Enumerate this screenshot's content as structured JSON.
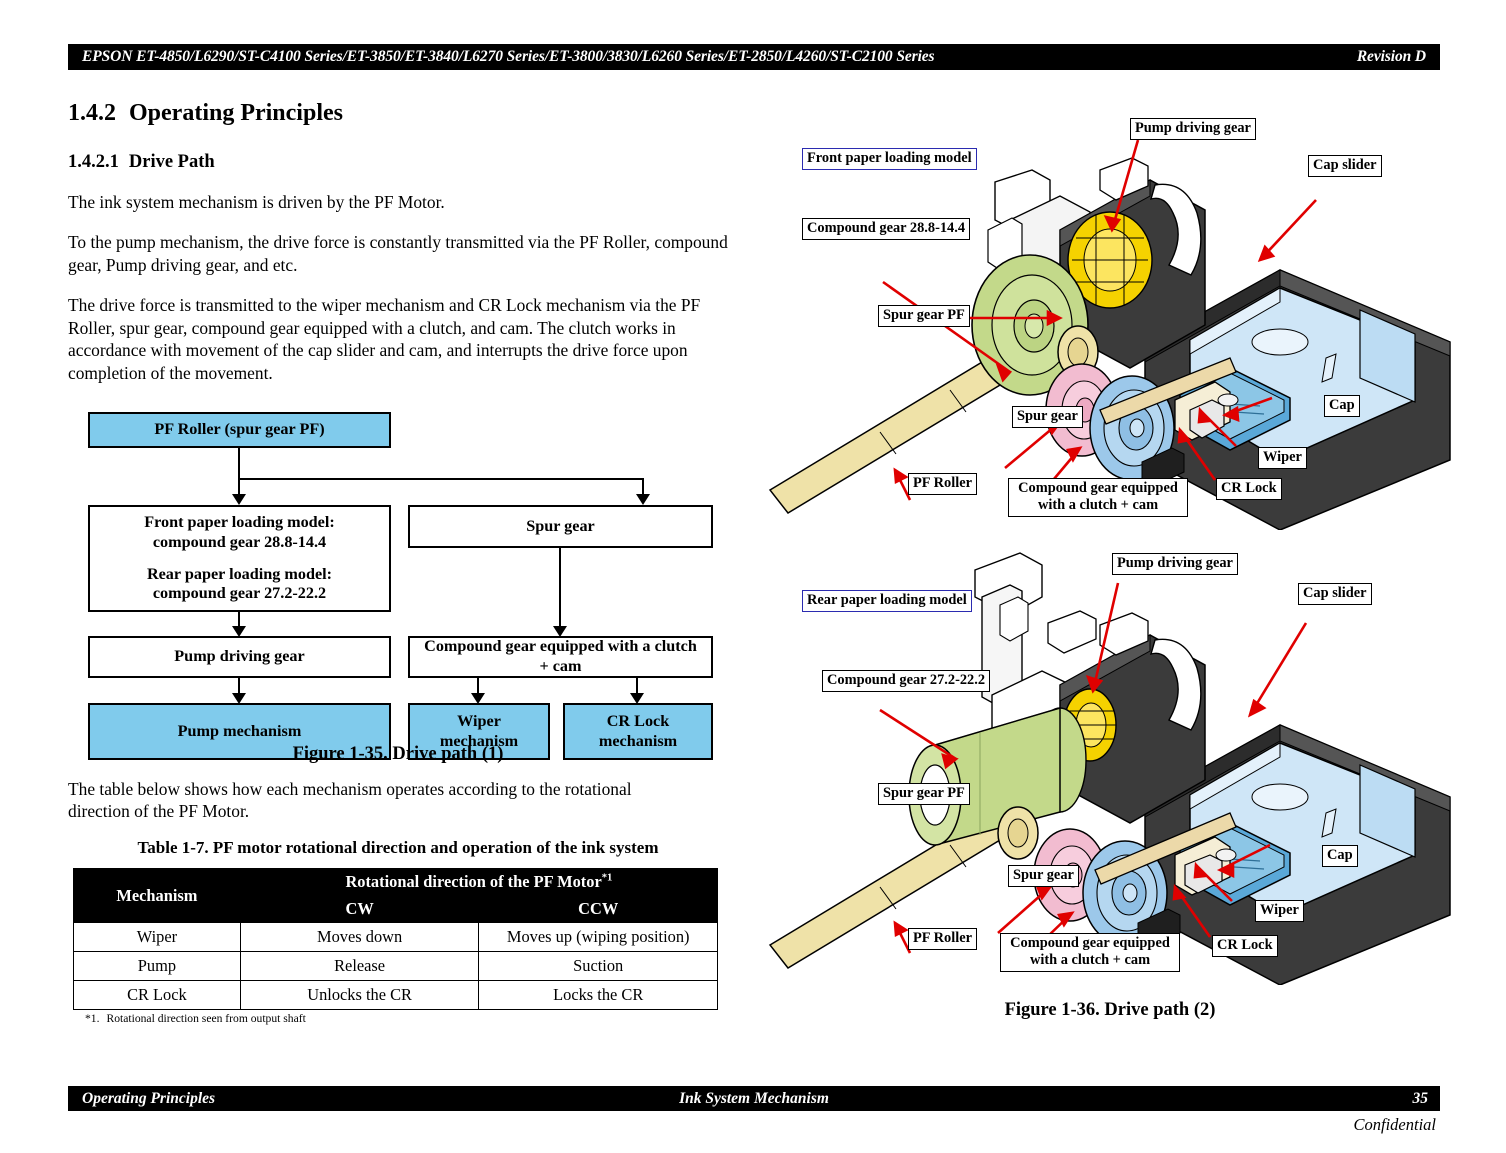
{
  "header": {
    "title": "EPSON ET-4850/L6290/ST-C4100 Series/ET-3850/ET-3840/L6270 Series/ET-3800/3830/L6260 Series/ET-2850/L4260/ST-C2100 Series",
    "revision": "Revision D"
  },
  "section": {
    "number": "1.4.2",
    "title": "Operating Principles",
    "sub_number": "1.4.2.1",
    "sub_title": "Drive Path",
    "paragraphs": [
      "The ink system mechanism is driven by the PF Motor.",
      "To the pump mechanism, the drive force is constantly transmitted via the PF Roller, compound gear, Pump driving gear, and etc.",
      "The drive force is transmitted to the wiper mechanism and CR Lock mechanism via the PF Roller, spur gear, compound gear equipped with a clutch, and cam. The clutch works in accordance with movement of the cap slider and cam, and interrupts the drive force upon completion of the movement.",
      "The table below shows how each mechanism operates according to the rotational direction of the PF Motor."
    ]
  },
  "flowchart": {
    "root": "PF Roller (spur gear PF)",
    "left_branch_line1": "Front paper loading model:",
    "left_branch_line2": "compound gear 28.8-14.4",
    "left_branch_line3": "Rear paper loading model:",
    "left_branch_line4": "compound gear 27.2-22.2",
    "right_branch": "Spur gear",
    "pump_driving_gear": "Pump driving gear",
    "clutch_cam_line1": "Compound gear equipped with a clutch",
    "clutch_cam_line2": "+ cam",
    "pump_mechanism": "Pump mechanism",
    "wiper_mechanism_line1": "Wiper",
    "wiper_mechanism_line2": "mechanism",
    "crlock_mechanism_line1": "CR Lock",
    "crlock_mechanism_line2": "mechanism",
    "caption": "Figure 1-35.  Drive path (1)",
    "accent_color": "#80cbec"
  },
  "table": {
    "title": "Table 1-7.  PF motor rotational direction and operation of the ink system",
    "header_mechanism": "Mechanism",
    "header_group": "Rotational direction of the PF Motor",
    "header_group_sup": "*1",
    "header_cw": "CW",
    "header_ccw": "CCW",
    "rows": [
      {
        "mechanism": "Wiper",
        "cw": "Moves down",
        "ccw": "Moves up (wiping position)"
      },
      {
        "mechanism": "Pump",
        "cw": "Release",
        "ccw": "Suction"
      },
      {
        "mechanism": "CR Lock",
        "cw": "Unlocks the CR",
        "ccw": "Locks the CR"
      }
    ],
    "footnote_marker": "*1.",
    "footnote_text": "Rotational direction seen from output shaft"
  },
  "figure1": {
    "caption": "",
    "labels": {
      "model": "Front paper loading model",
      "compound_gear": "Compound gear 28.8-14.4",
      "spur_gear_pf": "Spur gear PF",
      "pump_driving_gear": "Pump driving gear",
      "cap_slider": "Cap slider",
      "cap": "Cap",
      "wiper": "Wiper",
      "cr_lock": "CR Lock",
      "spur_gear": "Spur gear",
      "pf_roller": "PF Roller",
      "clutch_cam_line1": "Compound gear equipped",
      "clutch_cam_line2": "with a clutch + cam"
    }
  },
  "figure2": {
    "caption": "Figure 1-36.  Drive path (2)",
    "labels": {
      "model": "Rear paper loading model",
      "compound_gear": "Compound gear 27.2-22.2",
      "spur_gear_pf": "Spur gear PF",
      "pump_driving_gear": "Pump driving gear",
      "cap_slider": "Cap slider",
      "cap": "Cap",
      "wiper": "Wiper",
      "cr_lock": "CR Lock",
      "spur_gear": "Spur gear",
      "pf_roller": "PF Roller",
      "clutch_cam_line1": "Compound gear equipped",
      "clutch_cam_line2": "with a clutch + cam"
    }
  },
  "colors": {
    "gear_green": "#c3d98a",
    "gear_yellow": "#f5d200",
    "gear_pink": "#f2bcd0",
    "gear_blue": "#9cc8ea",
    "cap_slider_blue": "#cfe6f7",
    "cap_blue": "#5aa8d8",
    "roller_tan": "#efe2a8",
    "housing_dark": "#3b3b3b",
    "arrow_red": "#e00000"
  },
  "footer": {
    "left": "Operating Principles",
    "center": "Ink System Mechanism",
    "page": "35",
    "confidential": "Confidential"
  }
}
